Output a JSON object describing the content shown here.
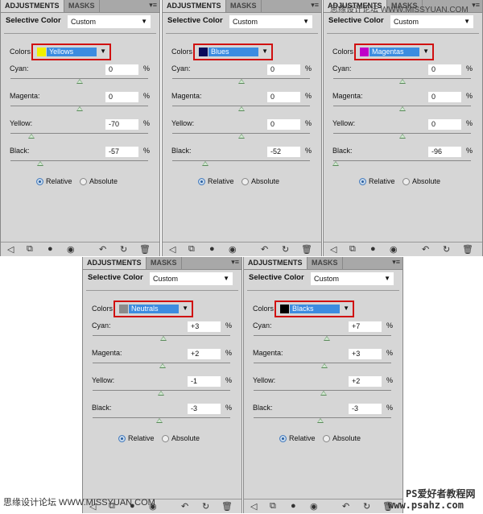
{
  "common": {
    "tab_adjustments": "ADJUSTMENTS",
    "tab_masks": "MASKS",
    "menu_icon": "panel-menu-icon",
    "title": "Selective Color",
    "preset": "Custom",
    "colors_label": "Colors",
    "relative": "Relative",
    "absolute": "Absolute",
    "percent": "%",
    "row_labels": [
      "Cyan:",
      "Magenta:",
      "Yellow:",
      "Black:"
    ]
  },
  "panels": [
    {
      "color": "Yellows",
      "swatch": "#f0f000",
      "values": [
        "0",
        "0",
        "-70",
        "-57"
      ],
      "mode": "relative"
    },
    {
      "color": "Blues",
      "swatch": "#0a0a5a",
      "values": [
        "0",
        "0",
        "0",
        "-52"
      ],
      "mode": "relative"
    },
    {
      "color": "Magentas",
      "swatch": "#c000c8",
      "values": [
        "0",
        "0",
        "0",
        "-96"
      ],
      "mode": "relative"
    },
    {
      "color": "Neutrals",
      "swatch": "#8a8a8a",
      "values": [
        "+3",
        "+2",
        "-1",
        "-3"
      ],
      "mode": "relative"
    },
    {
      "color": "Blacks",
      "swatch": "#000000",
      "values": [
        "+7",
        "+3",
        "+2",
        "-3"
      ],
      "mode": "relative"
    }
  ],
  "toolbar_icons": [
    "back-arrow-icon",
    "clip-layer-icon",
    "visibility-mask-icon",
    "eye-icon",
    "previous-state-icon",
    "reset-icon",
    "trash-icon"
  ],
  "watermarks": {
    "top": "思缘设计论坛 WWW.MISSYUAN.COM",
    "bottom_left": "思缘设计论坛 WWW.MISSYUAN.COM",
    "bottom_right_1": "PS爱好者教程网",
    "bottom_right_2": "www.psahz.com"
  }
}
